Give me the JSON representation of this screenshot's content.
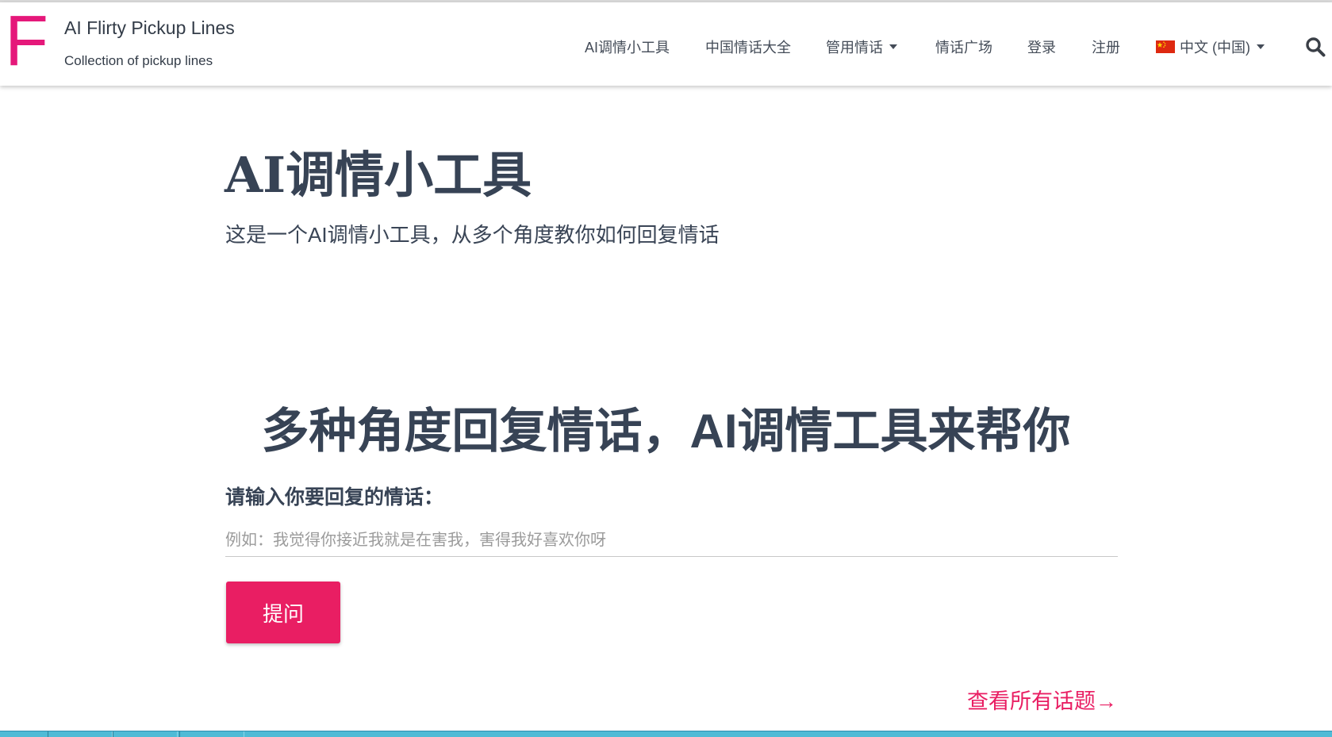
{
  "brand": {
    "logo_letter": "F",
    "title": "AI Flirty Pickup Lines",
    "subtitle": "Collection of pickup lines",
    "accent_color": "#e5187a"
  },
  "nav": {
    "items": [
      {
        "label": "AI调情小工具"
      },
      {
        "label": "中国情话大全"
      },
      {
        "label": "管用情话",
        "has_dropdown": true
      },
      {
        "label": "情话广场"
      },
      {
        "label": "登录"
      },
      {
        "label": "注册"
      }
    ],
    "language": {
      "label": "中文 (中国)",
      "flag_icon": "china-flag-icon"
    },
    "search_icon": "search-icon"
  },
  "hero": {
    "title": "AI调情小工具",
    "subtitle": "这是一个AI调情小工具，从多个角度教你如何回复情话"
  },
  "tool": {
    "heading": "多种角度回复情话，AI调情工具来帮你",
    "input_label": "请输入你要回复的情话：",
    "input_placeholder": "例如：我觉得你接近我就是在害我，害得我好喜欢你呀",
    "input_value": "",
    "submit_label": "提问",
    "button_color": "#e91e63"
  },
  "footer_link": {
    "label": "查看所有话题→"
  }
}
